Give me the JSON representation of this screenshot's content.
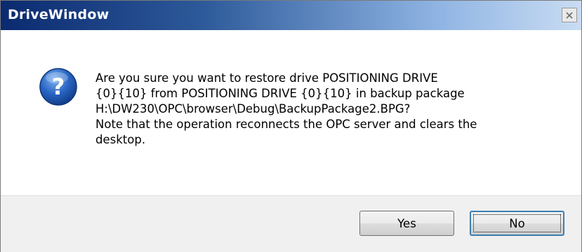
{
  "dialog": {
    "title": "DriveWindow",
    "close_icon": "close-icon",
    "icon": "question-icon",
    "message": "Are you sure you want to restore drive POSITIONING DRIVE\n{0}{10} from POSITIONING DRIVE {0}{10} in backup package\nH:\\DW230\\OPC\\browser\\Debug\\BackupPackage2.BPG?\nNote that the operation reconnects the OPC server and clears the\ndesktop.",
    "buttons": {
      "yes_label": "Yes",
      "no_label": "No"
    },
    "colors": {
      "title_bar_start": "#0b2a6f",
      "title_bar_end": "#c9dcf3",
      "footer_bg": "#f0f0f0",
      "icon_blue": "#1f5fbf"
    }
  }
}
